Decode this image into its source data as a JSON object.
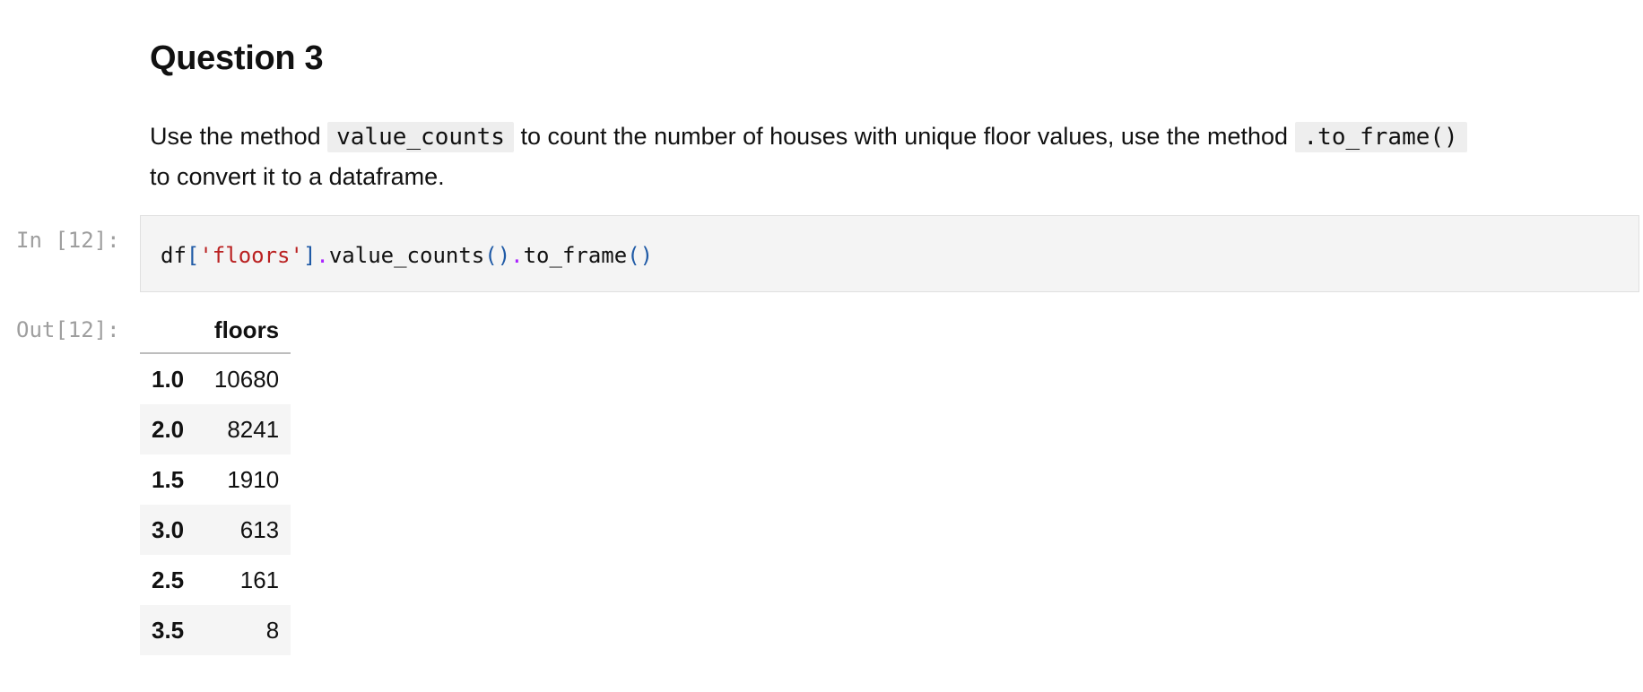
{
  "markdown": {
    "heading": "Question 3",
    "para_part1": "Use the method ",
    "code1": "value_counts",
    "para_part2": " to count the number of houses with unique floor values, use the method ",
    "code2": ".to_frame()",
    "para_part3": " to convert it to a dataframe."
  },
  "code_cell": {
    "prompt_in": "In [12]:",
    "prompt_out": "Out[12]:",
    "tokens": {
      "t1": "df",
      "t2": "[",
      "t3": "'floors'",
      "t4": "]",
      "t5": ".",
      "t6": "value_counts",
      "t7": "()",
      "t8": ".",
      "t9": "to_frame",
      "t10": "()"
    }
  },
  "output_table": {
    "column_header": "floors",
    "rows": [
      {
        "index": "1.0",
        "value": "10680"
      },
      {
        "index": "2.0",
        "value": "8241"
      },
      {
        "index": "1.5",
        "value": "1910"
      },
      {
        "index": "3.0",
        "value": "613"
      },
      {
        "index": "2.5",
        "value": "161"
      },
      {
        "index": "3.5",
        "value": "8"
      }
    ]
  }
}
